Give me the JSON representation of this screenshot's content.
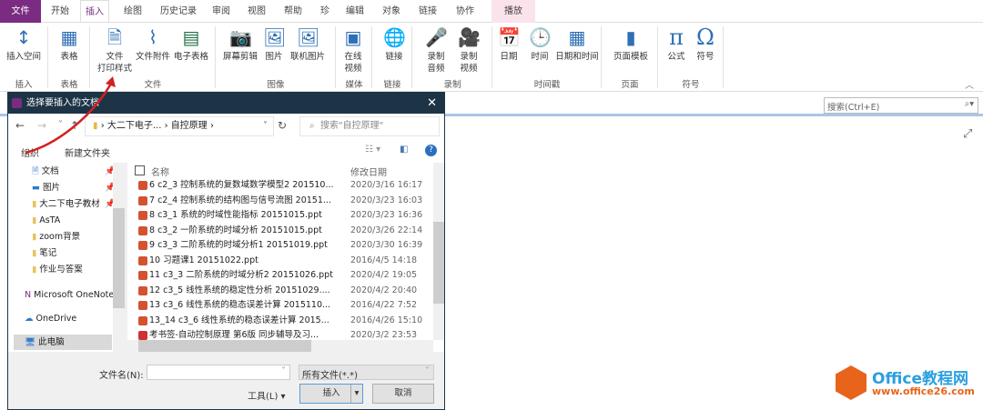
{
  "tabs": [
    "文件",
    "开始",
    "插入",
    "绘图",
    "历史记录",
    "审阅",
    "视图",
    "帮助",
    "珍",
    "编辑",
    "对象",
    "链接",
    "协作",
    "播放"
  ],
  "ribbon": {
    "buttons": [
      "插入空间",
      "表格",
      "文件\n打印样式",
      "文件附件",
      "电子表格",
      "屏幕剪辑",
      "图片",
      "联机图片",
      "在线\n视频",
      "链接",
      "录制\n音频",
      "录制\n视频",
      "日期",
      "时间",
      "日期和时间",
      "页面模板",
      "公式",
      "符号"
    ],
    "groups": [
      "插入",
      "表格",
      "文件",
      "图像",
      "媒体",
      "链接",
      "录制",
      "时间戳",
      "页面",
      "符号"
    ]
  },
  "search": {
    "placeholder": "搜索(Ctrl+E)"
  },
  "dialog": {
    "title": "选择要插入的文档",
    "breadcrumb": [
      "大二下电子...",
      "自控原理"
    ],
    "search_placeholder": "搜索\"自控原理\"",
    "organize": "组织",
    "new_folder": "新建文件夹",
    "col_name": "名称",
    "col_date": "修改日期",
    "nav": [
      "文档",
      "图片",
      "大二下电子教材",
      "AsTA",
      "zoom背景",
      "笔记",
      "作业与答案",
      "Microsoft OneNote",
      "OneDrive",
      "此电脑"
    ],
    "files": [
      {
        "name": "6 c2_3 控制系统的复数域数学模型2 201510...",
        "date": "2020/3/16 16:17"
      },
      {
        "name": "7 c2_4 控制系统的结构图与信号流图 20151...",
        "date": "2020/3/23 16:03"
      },
      {
        "name": "8 c3_1 系统的时域性能指标 20151015.ppt",
        "date": "2020/3/23 16:36"
      },
      {
        "name": "8 c3_2 一阶系统的时域分析 20151015.ppt",
        "date": "2020/3/26 22:14"
      },
      {
        "name": "9 c3_3 二阶系统的时域分析1 20151019.ppt",
        "date": "2020/3/30 16:39"
      },
      {
        "name": "10 习题课1 20151022.ppt",
        "date": "2016/4/5 14:18"
      },
      {
        "name": "11 c3_3 二阶系统的时域分析2 20151026.ppt",
        "date": "2020/4/2 19:05"
      },
      {
        "name": "12 c3_5 线性系统的稳定性分析 20151029....",
        "date": "2020/4/2 20:40"
      },
      {
        "name": "13 c3_6 线性系统的稳态误差计算 2015110...",
        "date": "2016/4/22 7:52"
      },
      {
        "name": "13_14 c3_6 线性系统的稳态误差计算 2015...",
        "date": "2016/4/26 15:10"
      },
      {
        "name": "考书签-自动控制原理 第6版 同步辅导及习...",
        "date": "2020/3/2 23:53"
      }
    ],
    "filename_label": "文件名(N):",
    "filetype": "所有文件(*.*)",
    "tools": "工具(L)",
    "insert": "插入",
    "cancel": "取消"
  },
  "watermark": {
    "title": "Office教程网",
    "url": "www.office26.com"
  },
  "colors": {
    "file_tab": "#7b2c82",
    "title_bar": "#1d3447",
    "accent": "#2e6fb5"
  }
}
